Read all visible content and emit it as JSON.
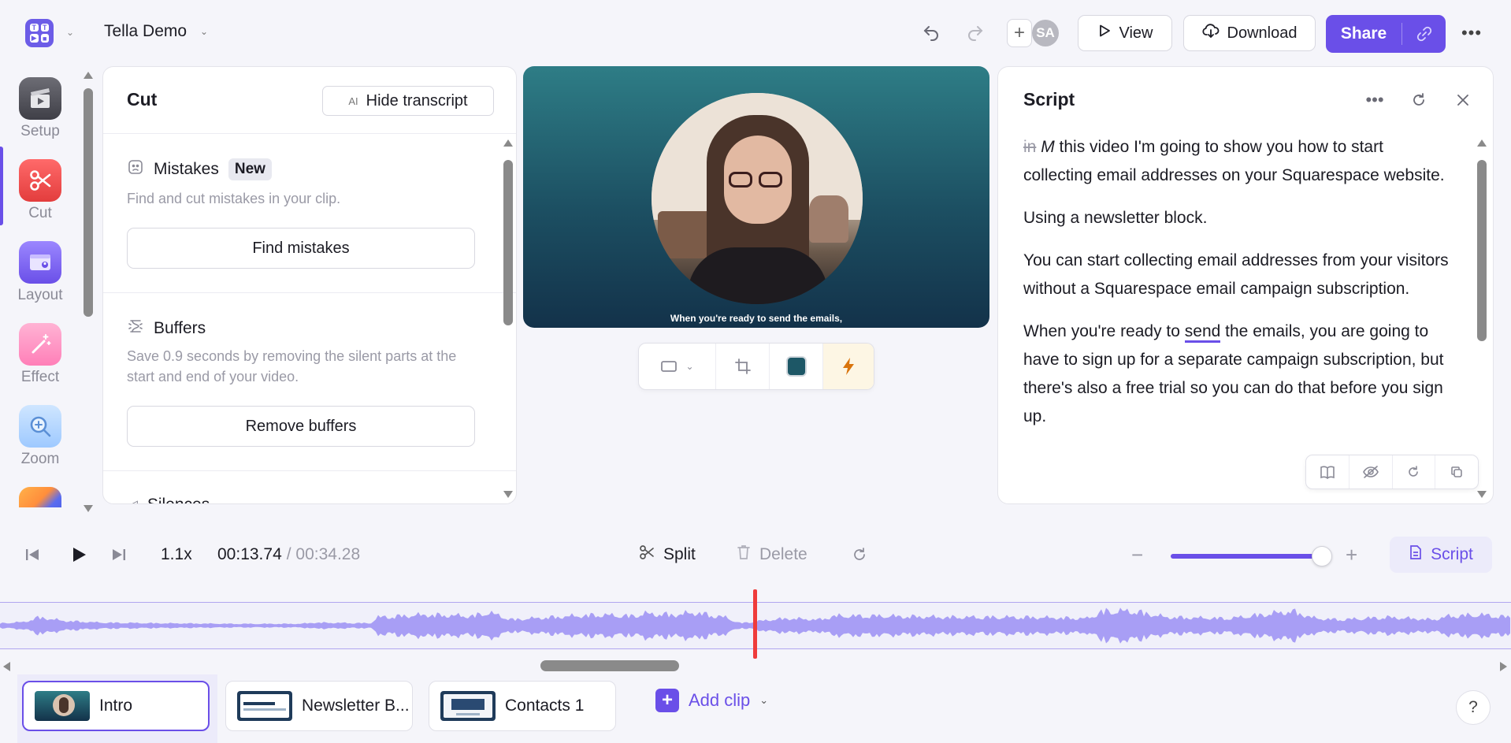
{
  "header": {
    "project_title": "Tella Demo",
    "avatar_initials": "SA",
    "view_label": "View",
    "download_label": "Download",
    "share_label": "Share",
    "brand_color": "#6a4fe8"
  },
  "sidebar": {
    "items": [
      {
        "label": "Setup",
        "icon": "clapperboard-icon"
      },
      {
        "label": "Cut",
        "icon": "scissors-icon",
        "active": true
      },
      {
        "label": "Layout",
        "icon": "layout-icon"
      },
      {
        "label": "Effect",
        "icon": "magic-wand-icon"
      },
      {
        "label": "Zoom",
        "icon": "magnifier-icon"
      }
    ]
  },
  "cut_panel": {
    "title": "Cut",
    "hide_transcript_label": "Hide transcript",
    "mistakes": {
      "title": "Mistakes",
      "badge": "New",
      "description": "Find and cut mistakes in your clip.",
      "button": "Find mistakes"
    },
    "buffers": {
      "title": "Buffers",
      "description": "Save 0.9 seconds by removing the silent parts at the start and end of your video.",
      "button": "Remove buffers"
    },
    "next_section_partial": "Silences"
  },
  "video": {
    "caption": "When you're ready to send the emails,"
  },
  "script_panel": {
    "title": "Script",
    "deleted_word": "in",
    "p1_rest": " this video I'm going to show you how to start collecting email addresses on your Squarespace website.",
    "p1_first": "M",
    "p2": "Using a newsletter block.",
    "p3": "You can start collecting email addresses from your visitors without a Squarespace email campaign subscription.",
    "p4_before": "When you're ready to ",
    "p4_highlight": "send",
    "p4_after": " the emails, you are going to have to sign up for a separate campaign subscription, but there's also a free trial so you can do that before you sign up."
  },
  "playback": {
    "speed": "1.1x",
    "current_time": "00:13.74",
    "total_time": "/ 00:34.28",
    "split_label": "Split",
    "delete_label": "Delete",
    "script_toggle_label": "Script",
    "zoom_level": 0.92
  },
  "clips": [
    {
      "label": "Intro",
      "active": true
    },
    {
      "label": "Newsletter B...",
      "active": false
    },
    {
      "label": "Contacts 1",
      "active": false
    }
  ],
  "add_clip_label": "Add clip",
  "help_label": "?"
}
